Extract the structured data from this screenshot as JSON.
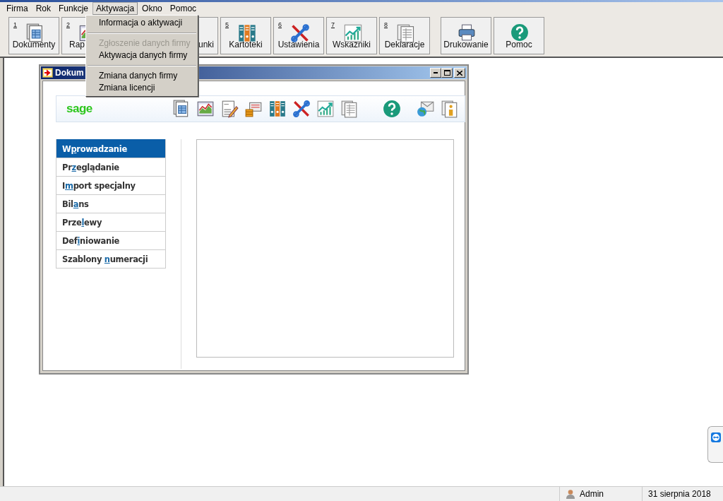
{
  "menu_bar": [
    {
      "label": "Firma",
      "selected": false
    },
    {
      "label": "Rok",
      "selected": false
    },
    {
      "label": "Funkcje",
      "selected": false
    },
    {
      "label": "Aktywacja",
      "selected": true
    },
    {
      "label": "Okno",
      "selected": false
    },
    {
      "label": "Pomoc",
      "selected": false
    }
  ],
  "open_menu": [
    {
      "kind": "item",
      "label": "Informacja o aktywacji",
      "disabled": false
    },
    {
      "kind": "separator"
    },
    {
      "kind": "item",
      "label": "Zgłoszenie danych firmy",
      "disabled": true
    },
    {
      "kind": "item",
      "label": "Aktywacja danych firmy",
      "disabled": false
    },
    {
      "kind": "separator"
    },
    {
      "kind": "item",
      "label": "Zmiana danych firmy",
      "disabled": false
    },
    {
      "kind": "item",
      "label": "Zmiana licencji",
      "disabled": false
    }
  ],
  "toolbar": [
    {
      "number": "1",
      "label": "Dokumenty"
    },
    {
      "number": "2",
      "label": "Rap"
    },
    {
      "label": "unki"
    },
    {
      "number": "5",
      "label": "Kartoteki"
    },
    {
      "number": "6",
      "label": "Ustawienia"
    },
    {
      "number": "7",
      "label": "Wskaźniki"
    },
    {
      "number": "8",
      "label": "Deklaracje"
    }
  ],
  "toolbar_right": [
    {
      "label": "Drukowanie"
    },
    {
      "label": "Pomoc"
    }
  ],
  "child_window": {
    "title": "Dokum",
    "logo": "sage",
    "nav": [
      {
        "parts": [
          "W",
          "p",
          "rowadzanie"
        ],
        "selected": true
      },
      {
        "parts": [
          "Pr",
          "z",
          "eglądanie"
        ],
        "selected": false
      },
      {
        "parts": [
          "I",
          "m",
          "port specjalny"
        ],
        "selected": false
      },
      {
        "parts": [
          "Bil",
          "a",
          "ns"
        ],
        "selected": false
      },
      {
        "parts": [
          "Prze",
          "l",
          "ewy"
        ],
        "selected": false
      },
      {
        "parts": [
          "Def",
          "i",
          "niowanie"
        ],
        "selected": false
      },
      {
        "parts": [
          "Szablony ",
          "n",
          "umeracji"
        ],
        "selected": false
      }
    ]
  },
  "status_bar": {
    "user": "Admin",
    "date": "31 sierpnia 2018"
  }
}
